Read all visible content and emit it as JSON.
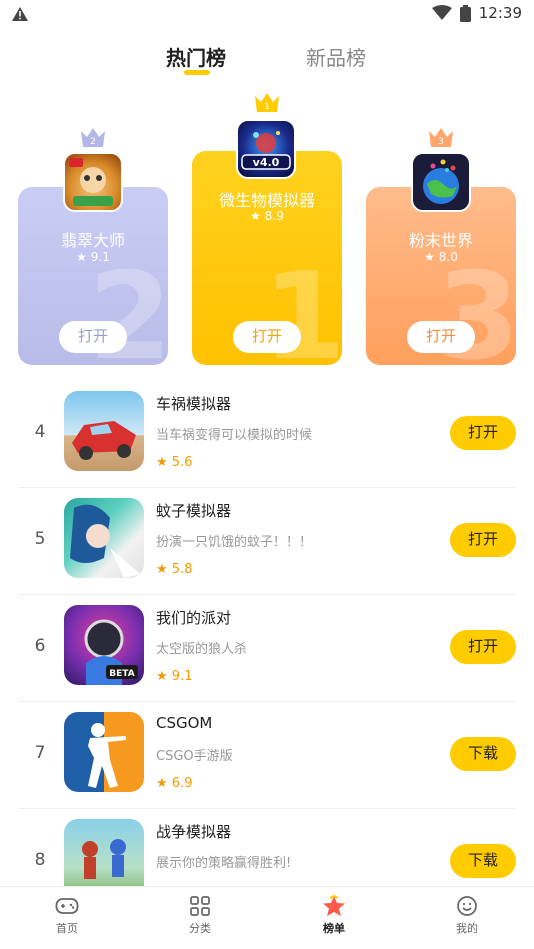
{
  "status": {
    "time": "12:39",
    "warn_icon": "warning-icon",
    "wifi_icon": "wifi-icon",
    "battery_icon": "battery-icon"
  },
  "tabs": [
    {
      "label": "热门榜",
      "active": true
    },
    {
      "label": "新品榜",
      "active": false
    }
  ],
  "podium": [
    {
      "rank": "2",
      "name": "翡翠大师",
      "rating": "9.1",
      "button": "打开",
      "color": "#b9bce8"
    },
    {
      "rank": "1",
      "name": "微生物模拟器",
      "rating": "8.9",
      "button": "打开",
      "color": "#ffc100"
    },
    {
      "rank": "3",
      "name": "粉末世界",
      "rating": "8.0",
      "button": "打开",
      "color": "#ff9f5c"
    }
  ],
  "list": [
    {
      "rank": "4",
      "name": "车祸模拟器",
      "desc": "当车祸变得可以模拟的时候",
      "rating": "5.6",
      "button": "打开"
    },
    {
      "rank": "5",
      "name": "蚊子模拟器",
      "desc": "扮演一只饥饿的蚊子！！！",
      "rating": "5.8",
      "button": "打开"
    },
    {
      "rank": "6",
      "name": "我们的派对",
      "desc": "太空版的狼人杀",
      "rating": "9.1",
      "button": "打开"
    },
    {
      "rank": "7",
      "name": "CSGOM",
      "desc": "CSGO手游版",
      "rating": "6.9",
      "button": "下载"
    },
    {
      "rank": "8",
      "name": "战争模拟器",
      "desc": "展示你的策略赢得胜利!",
      "rating": "",
      "button": "下载"
    }
  ],
  "nav": [
    {
      "label": "首页",
      "icon": "gamepad-icon",
      "active": false
    },
    {
      "label": "分类",
      "icon": "grid-icon",
      "active": false
    },
    {
      "label": "榜单",
      "icon": "star-badge-icon",
      "active": true
    },
    {
      "label": "我的",
      "icon": "smiley-icon",
      "active": false
    }
  ],
  "accent": "#ffcc00",
  "rating_star": "★"
}
